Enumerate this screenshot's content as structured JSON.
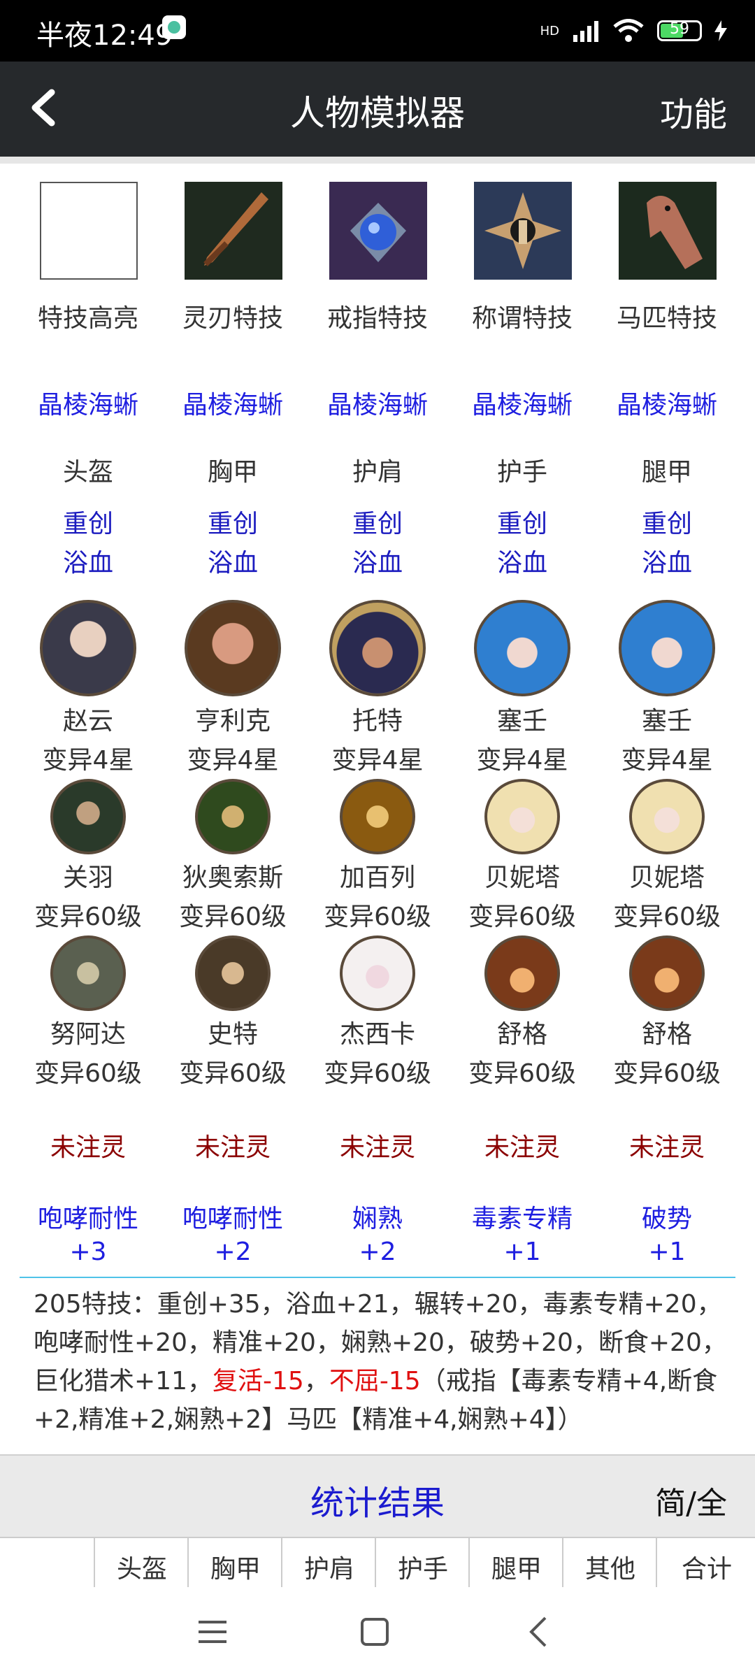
{
  "status": {
    "time": "半夜12:49",
    "battery": "59",
    "network": "HD"
  },
  "header": {
    "title": "人物模拟器",
    "function_label": "功能"
  },
  "skills": {
    "labels": [
      "特技高亮",
      "灵刃特技",
      "戒指特技",
      "称谓特技",
      "马匹特技"
    ],
    "icons": [
      "blank-slot",
      "blade-icon",
      "ring-icon",
      "title-emblem-icon",
      "horse-icon"
    ]
  },
  "skill_name_row": [
    "晶棱海蜥",
    "晶棱海蜥",
    "晶棱海蜥",
    "晶棱海蜥",
    "晶棱海蜥"
  ],
  "armor": {
    "slots": [
      "头盔",
      "胸甲",
      "护肩",
      "护手",
      "腿甲"
    ],
    "line1": [
      "重创",
      "重创",
      "重创",
      "重创",
      "重创"
    ],
    "line2": [
      "浴血",
      "浴血",
      "浴血",
      "浴血",
      "浴血"
    ]
  },
  "heroes_row1": {
    "names": [
      "赵云",
      "亨利克",
      "托特",
      "塞壬",
      "塞壬"
    ],
    "levels": [
      "变异4星",
      "变异4星",
      "变异4星",
      "变异4星",
      "变异4星"
    ]
  },
  "heroes_row2": {
    "names": [
      "关羽",
      "狄奥索斯",
      "加百列",
      "贝妮塔",
      "贝妮塔"
    ],
    "levels": [
      "变异60级",
      "变异60级",
      "变异60级",
      "变异60级",
      "变异60级"
    ]
  },
  "heroes_row3": {
    "names": [
      "努阿达",
      "史特",
      "杰西卡",
      "舒格",
      "舒格"
    ],
    "levels": [
      "变异60级",
      "变异60级",
      "变异60级",
      "变异60级",
      "变异60级"
    ]
  },
  "spirit": [
    "未注灵",
    "未注灵",
    "未注灵",
    "未注灵",
    "未注灵"
  ],
  "bonus": {
    "names": [
      "咆哮耐性",
      "咆哮耐性",
      "娴熟",
      "毒素专精",
      "破势"
    ],
    "values": [
      "+3",
      "+2",
      "+2",
      "+1",
      "+1"
    ]
  },
  "summary": {
    "part1": "205特技：重创+35，浴血+21，辗转+20，毒素专精+20，咆哮耐性+20，精准+20，娴熟+20，破势+20，断食+20，巨化猎术+11，",
    "red1": "复活-15",
    "sep": "，",
    "red2": "不屈-15",
    "part2": "（戒指【毒素专精+4,断食+2,精准+2,娴熟+2】马匹【精准+4,娴熟+4】）"
  },
  "stats": {
    "title": "统计结果",
    "toggle": "简/全",
    "columns": [
      "头盔",
      "胸甲",
      "护肩",
      "护手",
      "腿甲",
      "其他",
      "合计"
    ]
  },
  "colors": {
    "link_blue": "#1e1ee0",
    "dark_red": "#8b0000",
    "highlight_red": "#e01010",
    "titlebar": "#26292c"
  }
}
